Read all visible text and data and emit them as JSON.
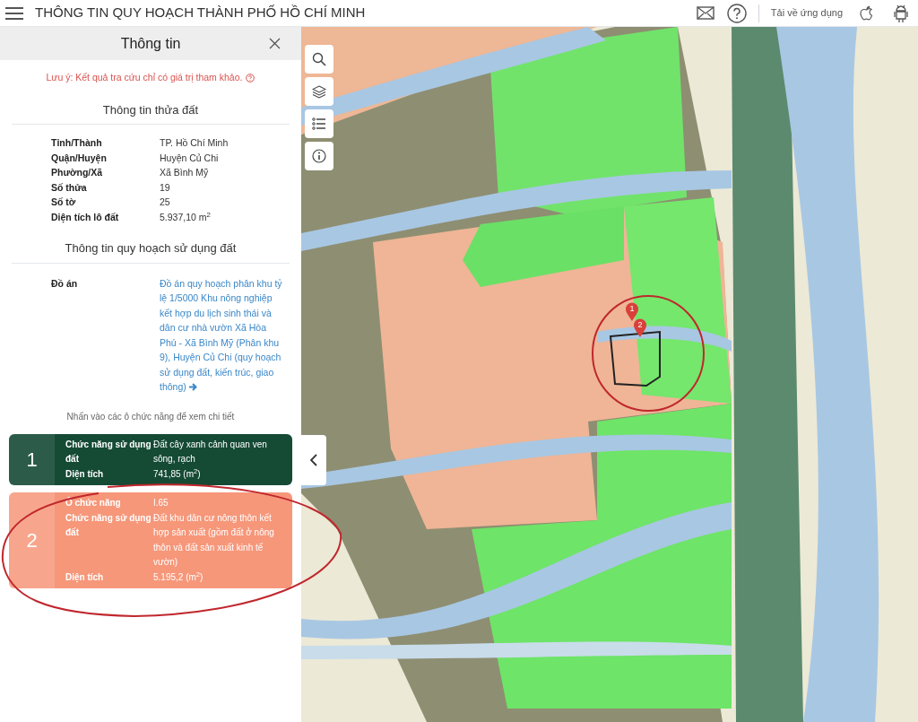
{
  "header": {
    "title": "THÔNG TIN QUY HOẠCH THÀNH PHỐ HỒ CHÍ MINH",
    "download_label": "Tải về ứng dụng"
  },
  "panel": {
    "title": "Thông tin",
    "note": "Lưu ý: Kết quả tra cứu chỉ có giá trị tham khảo.",
    "parcel_section": {
      "title": "Thông tin thửa đất",
      "rows": [
        {
          "label": "Tỉnh/Thành",
          "value": "TP. Hồ Chí Minh"
        },
        {
          "label": "Quận/Huyện",
          "value": "Huyện Củ Chi"
        },
        {
          "label": "Phường/Xã",
          "value": "Xã Bình Mỹ"
        },
        {
          "label": "Số thửa",
          "value": "19"
        },
        {
          "label": "Số tờ",
          "value": "25"
        },
        {
          "label": "Diện tích lô đất",
          "value": "5.937,10 m$^{2}$"
        }
      ]
    },
    "planning_section": {
      "title": "Thông tin quy hoạch sử dụng đất",
      "project_label": "Đồ án",
      "project_link": "Đồ án quy hoạch phân khu tỷ lệ 1/5000 Khu nông nghiệp kết hợp du lịch sinh thái và dân cư nhà vườn Xã Hòa Phú - Xã Bình Mỹ (Phân khu 9), Huyện Củ Chi (quy hoạch sử dụng đất, kiến trúc, giao thông)"
    },
    "hint": "Nhấn vào các ô chức năng để xem chi tiết",
    "zones": [
      {
        "number": "1",
        "color": "#154a35",
        "rows": [
          {
            "label": "Chức năng sử dụng đất",
            "value": "Đất cây xanh cảnh quan ven sông, rạch"
          },
          {
            "label": "Diện tích",
            "value": "741,85 (m$^{2}$)"
          }
        ]
      },
      {
        "number": "2",
        "color": "#f6977a",
        "rows": [
          {
            "label": "Ô chức năng",
            "value": "I.65"
          },
          {
            "label": "Chức năng sử dụng đất",
            "value": "Đất khu dân cư nông thôn kết hợp sản xuất (gồm đất ở nông thôn và đất sản xuất kinh tế vườn)"
          },
          {
            "label": "Diện tích",
            "value": "5.195,2 (m$^{2}$)"
          }
        ]
      }
    ]
  },
  "map": {
    "markers": [
      {
        "label": "1"
      },
      {
        "label": "2"
      }
    ]
  }
}
